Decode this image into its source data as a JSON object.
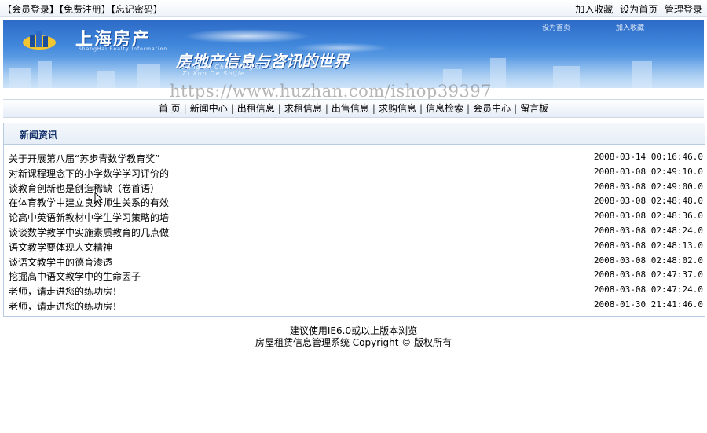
{
  "topbar": {
    "left_links": [
      "【会员登录】",
      "【免费注册】",
      "【忘记密码】"
    ],
    "right_links": [
      "加入收藏",
      "设为首页",
      "管理登录"
    ]
  },
  "banner": {
    "logo_text": "上海房产",
    "logo_sub": "ShangHai Realty Information",
    "slogan": "房地产信息与咨讯的世界",
    "slogan_sub1": "Fang Di Chan XingXi Yu",
    "slogan_sub2": "Zi Xun De ShiJie",
    "quick1": "设为首页",
    "quick2": "加入收藏"
  },
  "watermark": "https://www.huzhan.com/ishop39397",
  "nav": {
    "items": [
      "首 页",
      "新闻中心",
      "出租信息",
      "求租信息",
      "出售信息",
      "求购信息",
      "信息检索",
      "会员中心",
      "留言板"
    ]
  },
  "news": {
    "heading": "新闻资讯",
    "items": [
      {
        "title": "关于开展第八届“苏步青数学教育奖”",
        "date": "2008-03-14 00:16:46.0"
      },
      {
        "title": "对新课程理念下的小学数学学习评价的",
        "date": "2008-03-08 02:49:10.0"
      },
      {
        "title": "谈教育创新也是创造稀缺（卷首语）",
        "date": "2008-03-08 02:49:00.0"
      },
      {
        "title": "在体育教学中建立良好师生关系的有效",
        "date": "2008-03-08 02:48:48.0"
      },
      {
        "title": "论高中英语新教材中学生学习策略的培",
        "date": "2008-03-08 02:48:36.0"
      },
      {
        "title": "谈谈数学教学中实施素质教育的几点做",
        "date": "2008-03-08 02:48:24.0"
      },
      {
        "title": "语文教学要体现人文精神",
        "date": "2008-03-08 02:48:13.0"
      },
      {
        "title": "谈语文教学中的德育渗透",
        "date": "2008-03-08 02:48:02.0"
      },
      {
        "title": "挖掘高中语文教学中的生命因子",
        "date": "2008-03-08 02:47:37.0"
      },
      {
        "title": "老师，请走进您的练功房！",
        "date": "2008-03-08 02:47:24.0"
      },
      {
        "title": "老师，请走进您的练功房！",
        "date": "2008-01-30 21:41:46.0"
      }
    ]
  },
  "footer": {
    "line1": "建议使用IE6.0或以上版本浏览",
    "line2": "房屋租赁信息管理系统 Copyright © 版权所有"
  },
  "colors": {
    "banner_blue": "#3f86db",
    "heading_navy": "#14306a",
    "panel_border": "#b8cce4"
  }
}
